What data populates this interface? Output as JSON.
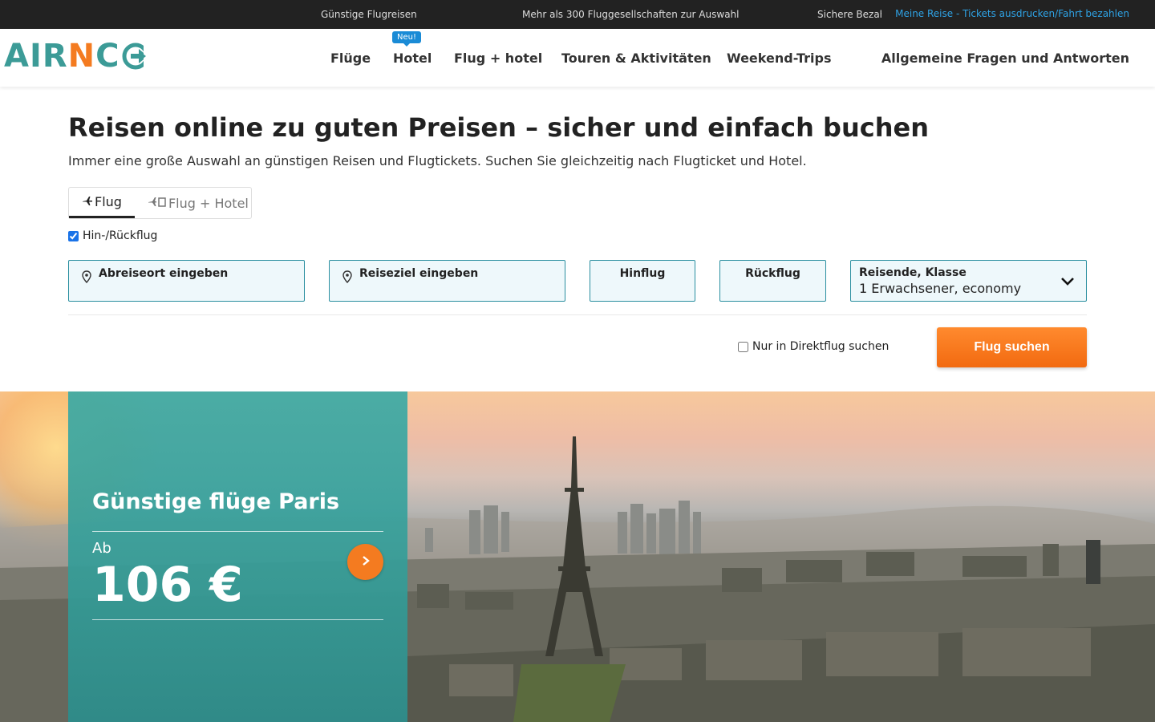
{
  "topbar": {
    "usp1": "Günstige Flugreisen",
    "usp2": "Mehr als 300 Fluggesellschaften zur Auswahl",
    "usp3": "Sichere Bezahlung",
    "my_trip": "Meine Reise - Tickets ausdrucken/Fahrt bezahlen"
  },
  "logo": {
    "part1": "AIR",
    "part2": "N",
    "part3": "C"
  },
  "nav": {
    "items": [
      "Flüge",
      "Hotel",
      "Flug + hotel",
      "Touren & Aktivitäten",
      "Weekend-Trips",
      "Allgemeine Fragen und Antworten"
    ],
    "hotel_badge": "Neu!"
  },
  "hero": {
    "headline": "Reisen online zu guten Preisen – sicher und einfach buchen",
    "subline": "Immer eine große Auswahl an günstigen Reisen und Flugtickets. Suchen Sie gleichzeitig nach Flugticket und Hotel."
  },
  "tabs": [
    {
      "label": "Flug",
      "icon": "plane-icon"
    },
    {
      "label": "Flug + Hotel",
      "icon": "plane-hotel-icon"
    }
  ],
  "search": {
    "round_trip_label": "Hin-/Rückflug",
    "origin_label": "Abreiseort eingeben",
    "destination_label": "Reiseziel eingeben",
    "depart_label": "Hinflug",
    "return_label": "Rückflug",
    "travellers_label": "Reisende, Klasse",
    "travellers_value": "1 Erwachsener, economy",
    "direct_label": "Nur in Direktflug suchen",
    "submit_label": "Flug suchen"
  },
  "banner": {
    "destination": "Günstige flüge Paris",
    "from_label": "Ab",
    "price": "106 €"
  },
  "colors": {
    "brand_teal": "#3c9b97",
    "brand_orange": "#f47b20",
    "link_blue": "#2fa3e6"
  }
}
